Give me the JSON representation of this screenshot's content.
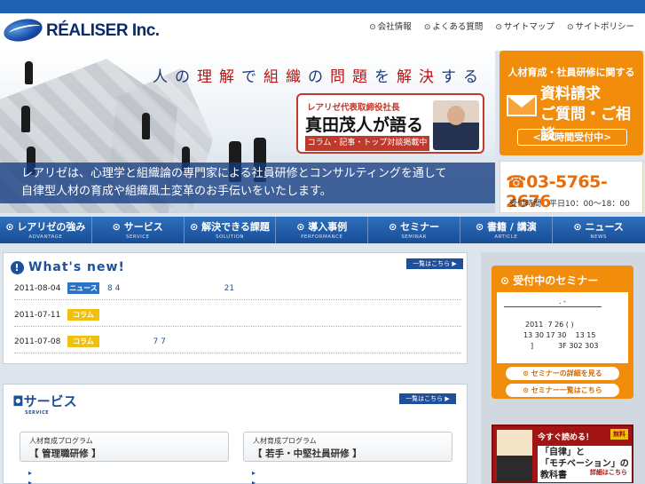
{
  "logo": {
    "text": "RÉALISER Inc."
  },
  "toplinks": [
    "会社情報",
    "よくある質問",
    "サイトマップ",
    "サイトポリシー"
  ],
  "hero": {
    "tagline_chars": [
      "人",
      "の",
      "理",
      "解",
      "で",
      "組",
      "織",
      "の",
      "問",
      "題",
      "を",
      "解",
      "決",
      "す",
      "る"
    ],
    "ceo_sub": "レアリゼ代表取締役社長",
    "ceo_title": "真田茂人が語る",
    "ceo_note": "コラム・記事・トップ対談掲載中",
    "band_line1": "レアリゼは、心理学と組織論の専門家による社員研修とコンサルティングを通して",
    "band_line2": "自律型人材の育成や組織風土変革のお手伝いをいたします。"
  },
  "cta": {
    "top": "人材育成・社員研修に関する",
    "main_line1": "資料請求",
    "main_line2": "ご質問・ご相談",
    "hours": "<24時間受付中>",
    "phone": "☎03-5765-2676",
    "phone_hours": "受付時間　平日10：00～18：00"
  },
  "nav": [
    {
      "label": "レアリゼの強み",
      "sub": "ADVANTAGE"
    },
    {
      "label": "サービス",
      "sub": "SERVICE"
    },
    {
      "label": "解決できる課題",
      "sub": "SOLUTION"
    },
    {
      "label": "導入事例",
      "sub": "PERFORMANCE"
    },
    {
      "label": "セミナー",
      "sub": "SEMINAR"
    },
    {
      "label": "書籍 / 講演",
      "sub": "ARTICLE"
    },
    {
      "label": "ニュース",
      "sub": "NEWS"
    }
  ],
  "news": {
    "title": "What's new!",
    "more": "一覧はこちら ▶",
    "rows": [
      {
        "date": "2011-08-04",
        "badge": "ニュース",
        "kind": "news",
        "text": "8 4                                         21"
      },
      {
        "date": "2011-07-11",
        "badge": "コラム",
        "kind": "column",
        "text": ""
      },
      {
        "date": "2011-07-08",
        "badge": "コラム",
        "kind": "column",
        "text": "                  7 7"
      }
    ]
  },
  "services": {
    "title": "サービス",
    "title_sub": "SERVICE",
    "more": "一覧はこちら ▶",
    "cards": [
      {
        "kicker": "人材育成プログラム",
        "name": "【 管理職研修 】"
      },
      {
        "kicker": "人材育成プログラム",
        "name": "【 若手・中堅社員研修 】"
      }
    ]
  },
  "seminar": {
    "title": "受付中のセミナー",
    "line1": ". -",
    "line2": "2011  7 26 ( )",
    "line3": "13 30 17 30    13 15",
    "line4": "]           3F 302 303",
    "btn_detail": "セミナーの詳細を見る",
    "btn_list": "セミナー一覧はこちら"
  },
  "book": {
    "top": "今すぐ読める！",
    "tag": "無料",
    "title_line1": "「自律」と",
    "title_line2": "「モチベーション」の",
    "title_line3": "教科書",
    "btn": "詳細はこちら"
  }
}
